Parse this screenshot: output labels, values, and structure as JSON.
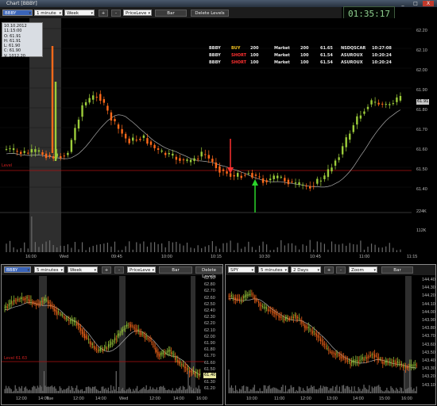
{
  "window": {
    "title": "Chart [BBBY]",
    "minimize": "_",
    "maximize": "□",
    "close": "X"
  },
  "clock": {
    "time": "01:35:17"
  },
  "main": {
    "symbol": "BBBY",
    "interval": "1 minute",
    "range": "Week",
    "plus": "+",
    "minus": "-",
    "indicator": "PriceLeve",
    "style": "Bar",
    "delete": "Delete Levels",
    "ohlc": {
      "date": "10.10.2012 11:15:00",
      "o": "O: 61.91",
      "h": "H: 61.91",
      "l": "L: 61.90",
      "c": "C: 61.90",
      "v": "V: 1012.20"
    },
    "orders": [
      {
        "sym": "BBBY",
        "side": "BUY",
        "qty": "200",
        "type": "Market",
        "filled": "200",
        "price": "61.65",
        "route": "NSDQSCAR",
        "time": "10:27:08"
      },
      {
        "sym": "BBBY",
        "side": "SHORT",
        "qty": "100",
        "type": "Market",
        "filled": "100",
        "price": "61.54",
        "route": "ASUROUX",
        "time": "10:20:24"
      },
      {
        "sym": "BBBY",
        "side": "SHORT",
        "qty": "100",
        "type": "Market",
        "filled": "100",
        "price": "61.54",
        "route": "ASUROUX",
        "time": "10:20:24"
      }
    ],
    "price_ticks": [
      "62.20",
      "62.10",
      "62.00",
      "61.90",
      "61.80",
      "61.70",
      "61.60",
      "61.50",
      "61.40"
    ],
    "current_price": "61.91",
    "level_label": "Level",
    "volume_ticks": [
      "224K",
      "112K"
    ],
    "time_ticks": [
      "16:00",
      "Wed",
      "09:45",
      "10:00",
      "10:15",
      "10:30",
      "10:45",
      "11:00",
      "11:15"
    ]
  },
  "left_panel": {
    "symbol": "BBBY",
    "interval": "5 minutes",
    "range": "Week",
    "plus": "+",
    "minus": "-",
    "indicator": "PriceLeve",
    "style": "Bar",
    "delete": "Delete Levels",
    "price_ticks": [
      "62.90",
      "62.80",
      "62.70",
      "62.60",
      "62.50",
      "62.40",
      "62.30",
      "62.20",
      "62.10",
      "62.00",
      "61.90",
      "61.80",
      "61.70",
      "61.60",
      "61.50",
      "61.40",
      "61.30",
      "61.20"
    ],
    "current_price": "61.40",
    "level_label": "Level 61.63",
    "time_ticks": [
      "12:00",
      "14:00",
      "Tue",
      "12:00",
      "14:00",
      "Wed",
      "12:00",
      "14:00",
      "16:00"
    ]
  },
  "right_panel": {
    "symbol": "SPY",
    "interval": "5 minutes",
    "range": "2 Days",
    "plus": "+",
    "minus": "-",
    "zoom": "Zoom",
    "style": "Bar",
    "price_ticks": [
      "144.40",
      "144.30",
      "144.20",
      "144.10",
      "144.00",
      "143.90",
      "143.80",
      "143.70",
      "143.60",
      "143.50",
      "143.40",
      "143.30",
      "143.20",
      "143.10"
    ],
    "time_ticks": [
      "10:00",
      "11:00",
      "12:00",
      "13:00",
      "14:00",
      "15:00",
      "16:00"
    ]
  },
  "colors": {
    "up": "#9ccc3a",
    "down": "#ff6a1a",
    "level": "#b01010",
    "ma": "#aaaaaa",
    "arrow": "#2bd42b",
    "downarrow": "#ff3030"
  }
}
